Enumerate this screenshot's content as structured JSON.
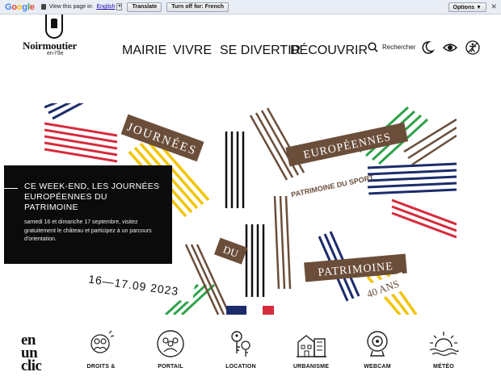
{
  "translate_bar": {
    "logo": [
      "G",
      "o",
      "o",
      "g",
      "l",
      "e"
    ],
    "view_text": "View this page in:",
    "language": "English",
    "translate_button": "Translate",
    "turn_off_button": "Turn off for: French",
    "options_button": "Options ▼",
    "close": "✕"
  },
  "header": {
    "logo_name": "Noirmoutier",
    "logo_sub": "en-l'île",
    "nav": [
      "MAIRIE",
      "VIVRE",
      "SE DIVERTIR",
      "DÉCOUVRIR"
    ],
    "search_label": "Rechercher",
    "icons": [
      "search-icon",
      "dark-mode-icon",
      "visibility-icon",
      "accessibility-icon"
    ]
  },
  "hero": {
    "words": [
      "JOURNÉES",
      "EUROPÉENNES",
      "PATRIMOINE DU SPORT",
      "DU",
      "PATRIMOINE",
      "40 ANS",
      "16—17.09 2023"
    ],
    "card_title": "CE WEEK-END, LES JOURNÉES EUROPÉENNES DU PATRIMOINE",
    "card_text": "samedi 16 et dimanche 17 septembre, visitez gratuitement le château et participez à un parcours d'orientation.",
    "colors": {
      "red": "#d62b3c",
      "navy": "#1c2c6b",
      "yellow": "#f2c500",
      "green": "#2ea24a",
      "brown": "#6b4e3a",
      "black": "#111111"
    }
  },
  "quick_links": {
    "title_lines": [
      "en",
      "un",
      "clic"
    ],
    "items": [
      {
        "label": "DROITS &",
        "icon": "rights-icon"
      },
      {
        "label": "PORTAIL",
        "icon": "portal-icon"
      },
      {
        "label": "LOCATION",
        "icon": "keys-icon"
      },
      {
        "label": "URBANISME",
        "icon": "buildings-icon"
      },
      {
        "label": "WEBCAM",
        "icon": "webcam-icon"
      },
      {
        "label": "MÉTÉO",
        "icon": "weather-icon"
      }
    ]
  }
}
